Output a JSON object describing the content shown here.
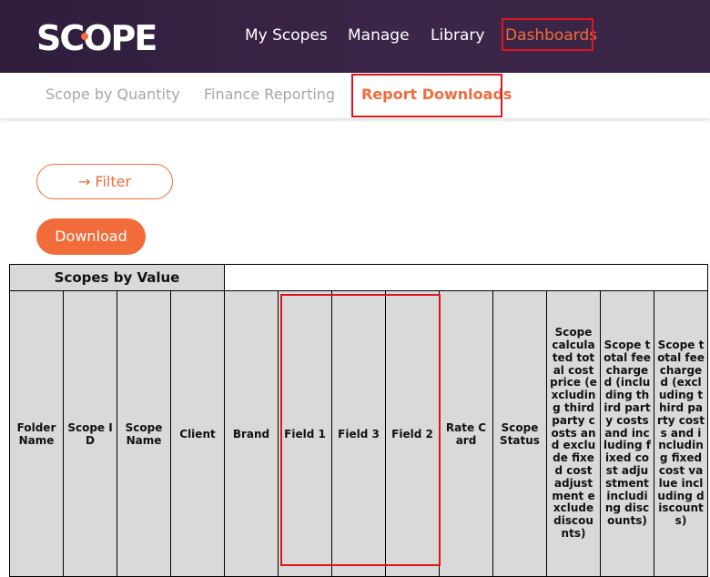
{
  "header": {
    "logo_text": "SCOPE",
    "nav": [
      {
        "label": "My Scopes"
      },
      {
        "label": "Manage"
      },
      {
        "label": "Library"
      },
      {
        "label": "Dashboards",
        "active": true
      }
    ]
  },
  "subnav": {
    "tabs": [
      {
        "label": "Scope by Quantity"
      },
      {
        "label": "Finance Reporting"
      },
      {
        "label": "Report Downloads",
        "active": true
      }
    ]
  },
  "actions": {
    "filter_label": "→ Filter",
    "download_label": "Download"
  },
  "table": {
    "group_title": "Scopes by Value",
    "columns": [
      "Folder Name",
      "Scope ID",
      "Scope Name",
      "Client",
      "Brand",
      "Field 1",
      "Field 3",
      "Field 2",
      "Rate Card",
      "Scope Status",
      "Scope calculated total cost price (excluding third party costs and exclude fixed cost adjustment exclude discounts)",
      "Scope total fee charged (including third party costs and including fixed cost adjustment including discounts)",
      "Scope total fee charged (excluding third party costs and including fixed cost value including discounts)"
    ]
  },
  "colors": {
    "header_bg": "#35213f",
    "accent": "#f26b3a",
    "highlight_box": "#e0151b",
    "table_header_bg": "#d9d9d9"
  }
}
